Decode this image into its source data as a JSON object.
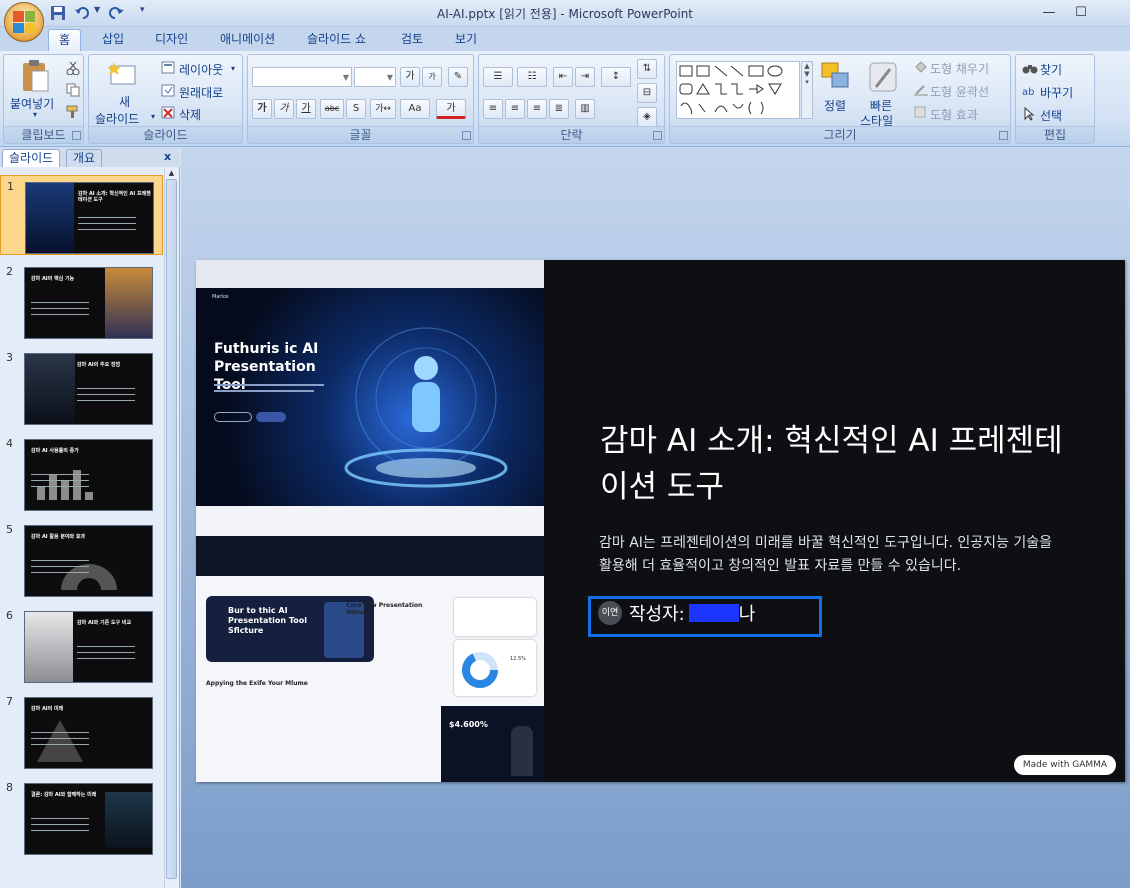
{
  "window": {
    "title": "AI-AI.pptx [읽기 전용] - Microsoft PowerPoint",
    "minimize": "—",
    "maximize": "☐"
  },
  "ribbon_tabs": [
    "홈",
    "삽입",
    "디자인",
    "애니메이션",
    "슬라이드 쇼",
    "검토",
    "보기"
  ],
  "ribbon": {
    "clipboard": {
      "paste": "붙여넣기",
      "label": "클립보드"
    },
    "slides": {
      "new_slide_line1": "새",
      "new_slide_line2": "슬라이드",
      "layout": "레이아웃",
      "reset": "원래대로",
      "delete": "삭제",
      "label": "슬라이드"
    },
    "font": {
      "label": "글꼴",
      "grow": "가",
      "shrink": "가",
      "bold": "가",
      "italic": "가",
      "underline": "가",
      "strike": "abc",
      "spacing": "가↔",
      "case": "Aa",
      "color": "가"
    },
    "paragraph": {
      "label": "단락"
    },
    "drawing": {
      "arrange": "정렬",
      "quick_styles_line1": "빠른",
      "quick_styles_line2": "스타일",
      "shape_fill": "도형 채우기",
      "shape_outline": "도형 윤곽선",
      "shape_effects": "도형 효과",
      "label": "그리기"
    },
    "editing": {
      "find": "찾기",
      "replace": "바꾸기",
      "select": "선택",
      "label": "편집"
    }
  },
  "pane": {
    "tab_slides": "슬라이드",
    "tab_outline": "개요",
    "close": "x",
    "slide_numbers": [
      "1",
      "2",
      "3",
      "4",
      "5",
      "6",
      "7",
      "8"
    ],
    "thumb_titles": [
      "감마 AI 소개: 혁신적인 AI 프레젠테이션 도구",
      "감마 AI의 핵심 기능",
      "감마 AI의 주요 장점",
      "감마 AI 사용률의 증가",
      "감마 AI 활용 분야와 효과",
      "감마 AI와 기존 도구 비교",
      "감마 AI의 미래",
      "결론: 감마 AI와 함께하는 미래"
    ]
  },
  "slide": {
    "title": "감마 AI 소개: 혁신적인 AI 프레젠테이션 도구",
    "description": "감마 AI는 프레젠테이션의 미래를 바꿀 혁신적인 도구입니다. 인공지능 기술을 활용해 더 효율적이고 창의적인 발표 자료를 만들 수 있습니다.",
    "author_avatar": "이연",
    "author_label": "작성자:",
    "author_tail": "나",
    "badge": "Made with GAMMA",
    "image": {
      "brand": "Marlox",
      "hero_title": "Futhuris ic AI Presentation Tool",
      "card_title": "Bur to thic AI Presentation Tool Sficture",
      "core_title": "Core Tow Presentation Nitrure",
      "apply_title": "Appying the Exife Your Mlume",
      "stat": "$4.600%",
      "donut_value": "12.5%"
    }
  },
  "colors": {
    "highlight": "#1470e6",
    "slide_bg": "#0e0f13",
    "ribbon_bg": "#d4e2f4",
    "selected_thumb": "#fbd68b"
  }
}
